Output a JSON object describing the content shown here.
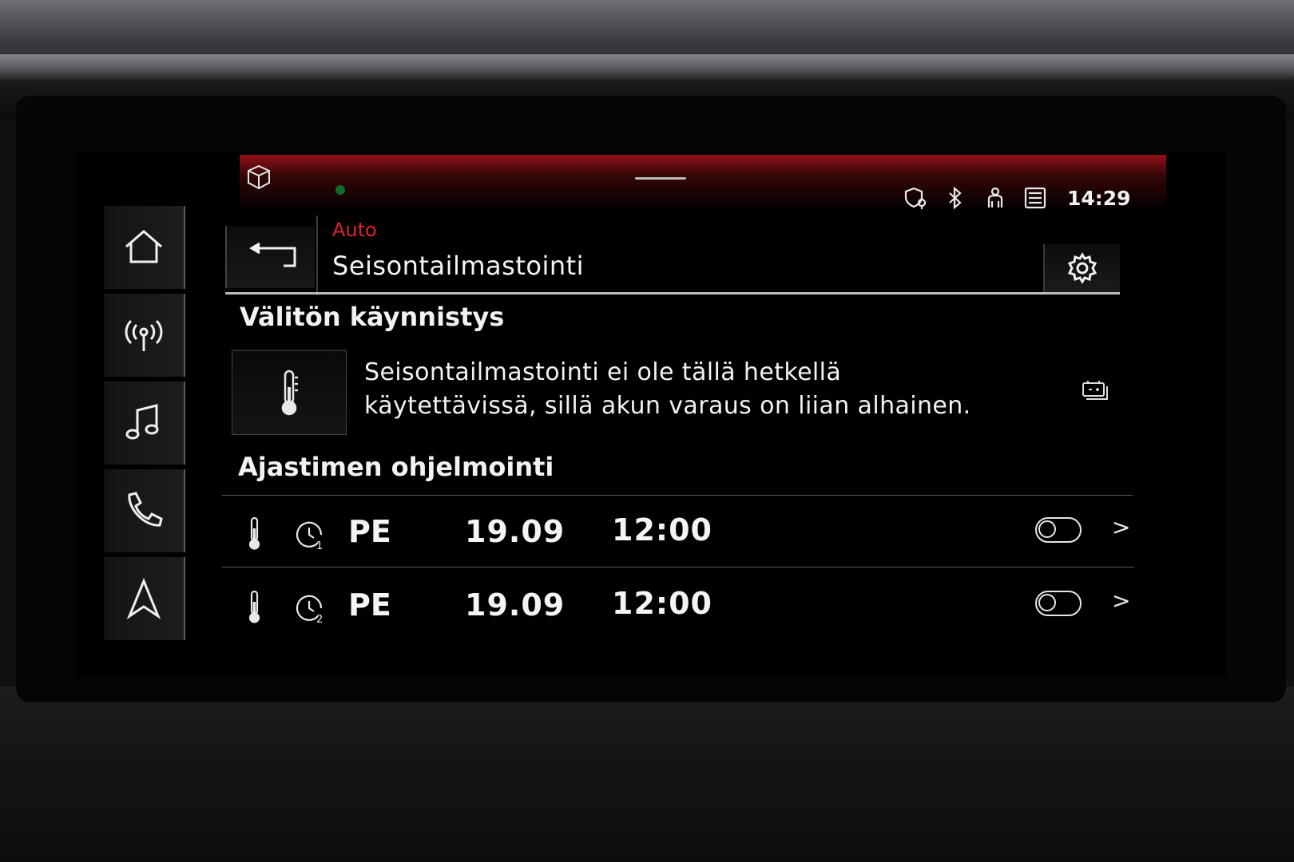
{
  "status_bar": {
    "time": "14:29",
    "icons": [
      "cube-icon",
      "shield-pin-icon",
      "bluetooth-icon",
      "person-icon",
      "traffic-sign-icon"
    ]
  },
  "sidebar": {
    "items": [
      {
        "name": "home",
        "icon": "home-icon"
      },
      {
        "name": "radio",
        "icon": "radio-antenna-icon"
      },
      {
        "name": "media",
        "icon": "music-note-icon"
      },
      {
        "name": "phone",
        "icon": "phone-icon"
      },
      {
        "name": "navigation",
        "icon": "navigation-arrow-icon"
      }
    ]
  },
  "header": {
    "breadcrumb": "Auto",
    "title": "Seisontailmastointi"
  },
  "immediate_start": {
    "heading": "Välitön käynnistys",
    "message_line1": "Seisontailmastointi ei ole tällä hetkellä",
    "message_line2": "käytettävissä, sillä akun varaus on liian alhainen."
  },
  "timers": {
    "heading": "Ajastimen ohjelmointi",
    "rows": [
      {
        "timer": "1",
        "day": "PE",
        "date": "19.09",
        "time": "12:00",
        "enabled": false
      },
      {
        "timer": "2",
        "day": "PE",
        "date": "19.09",
        "time": "12:00",
        "enabled": false
      }
    ]
  },
  "colors": {
    "accent_red": "#e0222a",
    "text": "#f2f2f2",
    "background": "#000000"
  }
}
